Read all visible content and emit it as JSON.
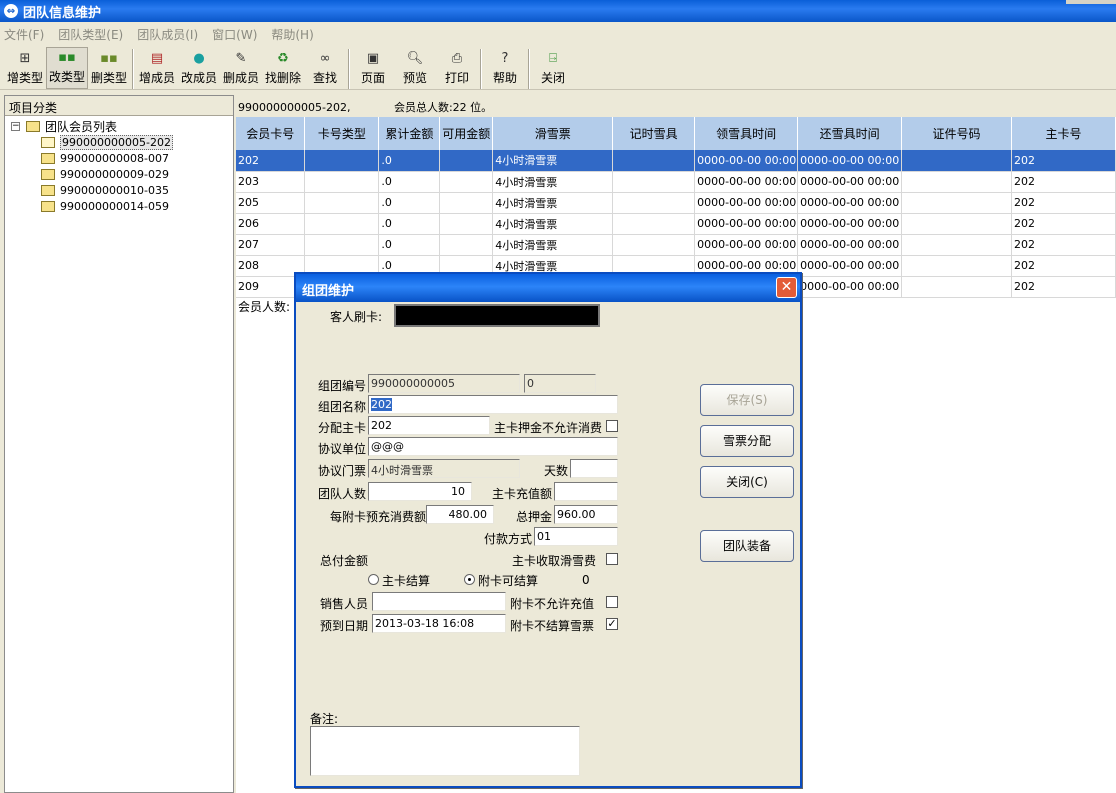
{
  "window": {
    "title": "团队信息维护"
  },
  "menu": [
    "文件(F)",
    "团队类型(E)",
    "团队成员(I)",
    "窗口(W)",
    "帮助(H)"
  ],
  "toolbar": {
    "add_type": "增类型",
    "edit_type": "改类型",
    "delete_type": "删类型",
    "add_member": "增成员",
    "edit_member": "改成员",
    "delete_member": "删成员",
    "find_deleted": "找删除",
    "search": "查找",
    "page": "页面",
    "preview": "预览",
    "print": "打印",
    "help": "帮助",
    "close": "关闭"
  },
  "left_panel": {
    "header": "项目分类",
    "root": "团队会员列表",
    "items": [
      "990000000005-202",
      "990000000008-007",
      "990000000009-029",
      "990000000010-035",
      "990000000014-059"
    ]
  },
  "info": {
    "group": "990000000005-202,",
    "total": "会员总人数:22 位。"
  },
  "grid": {
    "columns": [
      "会员卡号",
      "卡号类型",
      "累计金额",
      "可用金额",
      "滑雪票",
      "记时雪具",
      "领雪具时间",
      "还雪具时间",
      "证件号码",
      "主卡号"
    ],
    "rows": [
      [
        "202",
        "",
        ".0",
        "",
        "4小时滑雪票",
        "",
        "0000-00-00 00:00",
        "0000-00-00 00:00",
        "",
        "202"
      ],
      [
        "203",
        "",
        ".0",
        "",
        "4小时滑雪票",
        "",
        "0000-00-00 00:00",
        "0000-00-00 00:00",
        "",
        "202"
      ],
      [
        "205",
        "",
        ".0",
        "",
        "4小时滑雪票",
        "",
        "0000-00-00 00:00",
        "0000-00-00 00:00",
        "",
        "202"
      ],
      [
        "206",
        "",
        ".0",
        "",
        "4小时滑雪票",
        "",
        "0000-00-00 00:00",
        "0000-00-00 00:00",
        "",
        "202"
      ],
      [
        "207",
        "",
        ".0",
        "",
        "4小时滑雪票",
        "",
        "0000-00-00 00:00",
        "0000-00-00 00:00",
        "",
        "202"
      ],
      [
        "208",
        "",
        ".0",
        "",
        "4小时滑雪票",
        "",
        "0000-00-00 00:00",
        "0000-00-00 00:00",
        "",
        "202"
      ],
      [
        "209",
        "",
        "",
        "",
        "",
        "",
        "",
        "0000-00-00 00:00",
        "",
        "202"
      ]
    ],
    "member_count_label": "会员人数:"
  },
  "dialog": {
    "title": "组团维护",
    "swipe_label": "客人刷卡:",
    "group_no_label": "组团编号",
    "group_no": "990000000005",
    "group_no_suffix": "0",
    "group_name_label": "组团名称",
    "group_name": "202",
    "main_card_label": "分配主卡",
    "main_card": "202",
    "deposit_no_consume_label": "主卡押金不允许消费",
    "agreement_unit_label": "协议单位",
    "agreement_unit": "@@@",
    "agreement_ticket_label": "协议门票",
    "agreement_ticket": "4小时滑雪票",
    "days_label": "天数",
    "days": "",
    "team_count_label": "团队人数",
    "team_count": "10",
    "main_recharge_label": "主卡充值额",
    "main_recharge": "",
    "per_card_prepay_label": "每附卡预充消费额",
    "per_card_prepay": "480.00",
    "total_deposit_label": "总押金",
    "total_deposit": "960.00",
    "payment_label": "付款方式",
    "payment": "01",
    "total_paid_label": "总付金额",
    "main_collect_label": "主卡收取滑雪费",
    "radio_main": "主卡结算",
    "radio_sub": "附卡可结算",
    "settle_value": "0",
    "sales_label": "销售人员",
    "sales": "",
    "sub_no_recharge_label": "附卡不允许充值",
    "arrival_label": "预到日期",
    "arrival": "2013-03-18  16:08",
    "sub_no_settle_label": "附卡不结算雪票",
    "remarks_label": "备注:",
    "btn_save": "保存(S)",
    "btn_ticket": "雪票分配",
    "btn_close": "关闭(C)",
    "btn_equip": "团队装备"
  }
}
